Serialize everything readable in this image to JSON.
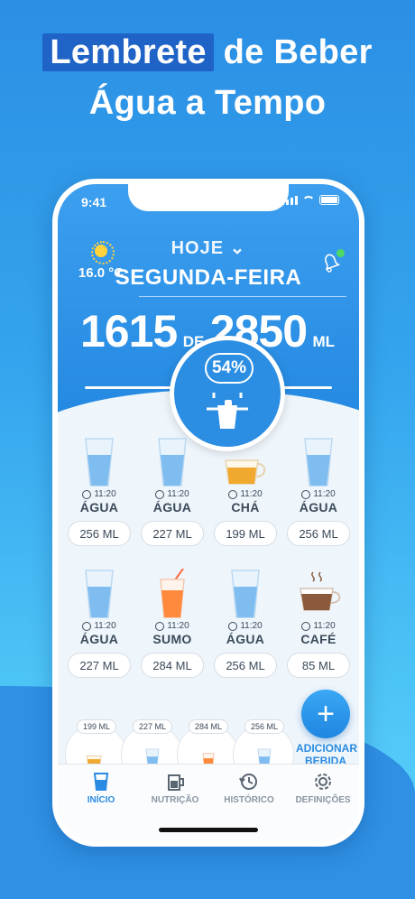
{
  "headline": {
    "highlight": "Lembrete",
    "line1_rest": " de Beber",
    "line2": "Água a Tempo"
  },
  "status": {
    "time": "9:41"
  },
  "weather": {
    "temperature": "16.0 °C",
    "icon": "sun-icon"
  },
  "header": {
    "date_selector": "HOJE ⌄",
    "day": "SEGUNDA-FEIRA"
  },
  "intake": {
    "current": "1615",
    "of": "DE",
    "goal": "2850",
    "unit": "ML",
    "percent": "54%"
  },
  "drinks": [
    {
      "time": "11:20",
      "name": "ÁGUA",
      "volume": "256 ML",
      "type": "water"
    },
    {
      "time": "11:20",
      "name": "ÁGUA",
      "volume": "227 ML",
      "type": "water"
    },
    {
      "time": "11:20",
      "name": "CHÁ",
      "volume": "199 ML",
      "type": "tea"
    },
    {
      "time": "11:20",
      "name": "ÁGUA",
      "volume": "256 ML",
      "type": "water"
    },
    {
      "time": "11:20",
      "name": "ÁGUA",
      "volume": "227 ML",
      "type": "water"
    },
    {
      "time": "11:20",
      "name": "SUMO",
      "volume": "284 ML",
      "type": "juice"
    },
    {
      "time": "11:20",
      "name": "ÁGUA",
      "volume": "256 ML",
      "type": "water"
    },
    {
      "time": "11:20",
      "name": "CAFÉ",
      "volume": "85 ML",
      "type": "coffee"
    }
  ],
  "quick_add": [
    "199 ML",
    "227 ML",
    "284 ML",
    "256 ML"
  ],
  "add_button": {
    "label_line1": "ADICIONAR",
    "label_line2": "BEBIDA"
  },
  "tabs": [
    {
      "label": "INÍCIO",
      "icon": "glass-icon",
      "active": true
    },
    {
      "label": "NUTRIÇÃO",
      "icon": "jug-icon",
      "active": false
    },
    {
      "label": "HISTÓRICO",
      "icon": "history-icon",
      "active": false
    },
    {
      "label": "DEFINIÇÕES",
      "icon": "gear-icon",
      "active": false
    }
  ],
  "colors": {
    "accent": "#2a8be2",
    "header_blue": "#2388e0",
    "juice": "#ff8a3d",
    "tea": "#f0a92e",
    "coffee": "#8a5a3b"
  }
}
